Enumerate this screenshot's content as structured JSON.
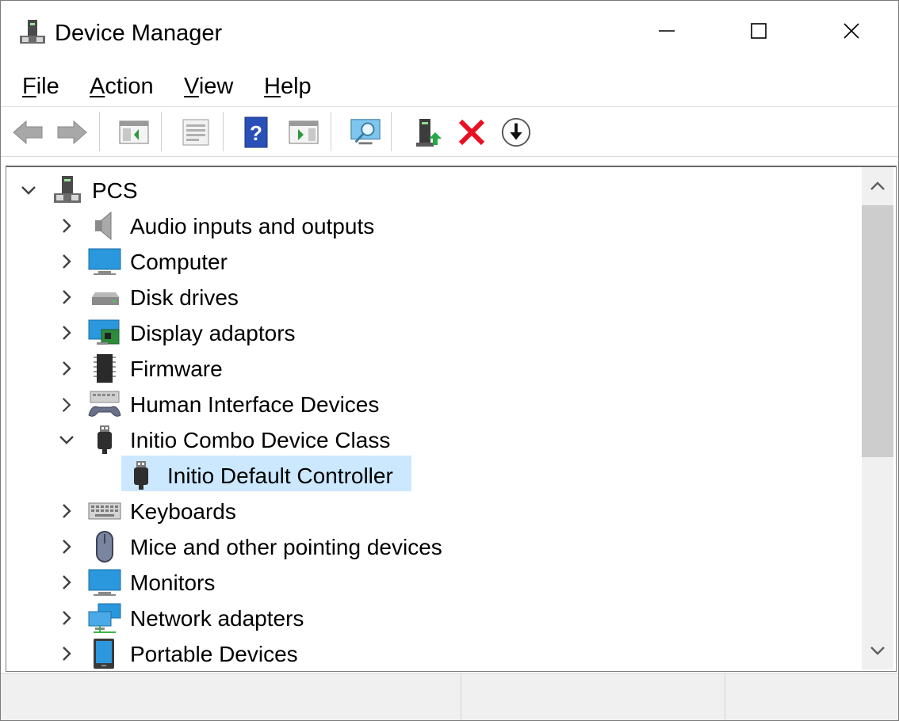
{
  "window": {
    "title": "Device Manager",
    "app_icon": "device-manager-icon"
  },
  "menu": [
    {
      "label_pre": "",
      "accel": "F",
      "label_post": "ile"
    },
    {
      "label_pre": "",
      "accel": "A",
      "label_post": "ction"
    },
    {
      "label_pre": "",
      "accel": "V",
      "label_post": "iew"
    },
    {
      "label_pre": "",
      "accel": "H",
      "label_post": "elp"
    }
  ],
  "toolbar": {
    "buttons": [
      "back-icon",
      "forward-icon",
      "show-hide-console-tree-icon",
      "properties-icon",
      "help-icon",
      "show-action-pane-icon",
      "scan-hardware-changes-icon",
      "update-driver-icon",
      "uninstall-device-icon",
      "disable-device-icon"
    ]
  },
  "tree": {
    "root": {
      "label": "PCS",
      "expanded": true,
      "icon": "computer-tower-icon"
    },
    "items": [
      {
        "label": "Audio inputs and outputs",
        "icon": "speaker-icon",
        "expanded": false
      },
      {
        "label": "Computer",
        "icon": "monitor-icon",
        "expanded": false
      },
      {
        "label": "Disk drives",
        "icon": "disk-drive-icon",
        "expanded": false
      },
      {
        "label": "Display adaptors",
        "icon": "display-adapter-icon",
        "expanded": false
      },
      {
        "label": "Firmware",
        "icon": "chip-icon",
        "expanded": false
      },
      {
        "label": "Human Interface Devices",
        "icon": "hid-icon",
        "expanded": false
      },
      {
        "label": "Initio Combo Device Class",
        "icon": "usb-plug-icon",
        "expanded": true,
        "children": [
          {
            "label": "Initio Default Controller",
            "icon": "usb-plug-icon",
            "selected": true
          }
        ]
      },
      {
        "label": "Keyboards",
        "icon": "keyboard-icon",
        "expanded": false
      },
      {
        "label": "Mice and other pointing devices",
        "icon": "mouse-icon",
        "expanded": false
      },
      {
        "label": "Monitors",
        "icon": "monitor-icon",
        "expanded": false
      },
      {
        "label": "Network adapters",
        "icon": "network-adapter-icon",
        "expanded": false
      },
      {
        "label": "Portable Devices",
        "icon": "portable-device-icon",
        "expanded": false
      }
    ]
  },
  "colors": {
    "selection": "#cce8ff",
    "accent_blue": "#1e90d8",
    "uninstall_red": "#e81123"
  },
  "statusbar": {
    "panes": [
      "",
      "",
      ""
    ]
  }
}
